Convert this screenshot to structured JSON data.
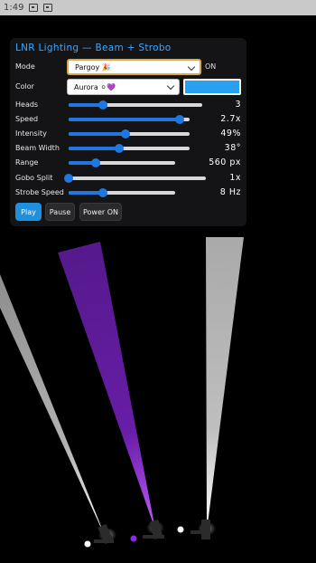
{
  "status_bar": {
    "time": "1:49",
    "icons": [
      "image-icon",
      "notification-icon"
    ]
  },
  "panel": {
    "title": "LNR Lighting — Beam + Strobo",
    "mode": {
      "label": "Mode",
      "value": "Pargoy 🎉",
      "toggle_label": "ON"
    },
    "color": {
      "label": "Color",
      "value": "Aurora ⚪💜",
      "swatch": "#2aa0f0"
    },
    "sliders": [
      {
        "label": "Heads",
        "value_text": "3",
        "fraction": 0.26
      },
      {
        "label": "Speed",
        "value_text": "2.7x",
        "fraction": 0.92
      },
      {
        "label": "Intensity",
        "value_text": "49%",
        "fraction": 0.47
      },
      {
        "label": "Beam Width",
        "value_text": "38°",
        "fraction": 0.42
      },
      {
        "label": "Range",
        "value_text": "560 px",
        "fraction": 0.25
      },
      {
        "label": "Gobo Split",
        "value_text": "1x",
        "fraction": 0.0
      },
      {
        "label": "Strobe Speed",
        "value_text": "8 Hz",
        "fraction": 0.32
      }
    ],
    "buttons": {
      "play": "Play",
      "pause": "Pause",
      "power": "Power ON"
    }
  },
  "beam_colors": [
    "#e6e6e6",
    "#7a22c4",
    "#e6e6e6"
  ],
  "colors": {
    "accent": "#1e78e0",
    "title": "#3aa6ff",
    "panel_bg": "#161618"
  }
}
